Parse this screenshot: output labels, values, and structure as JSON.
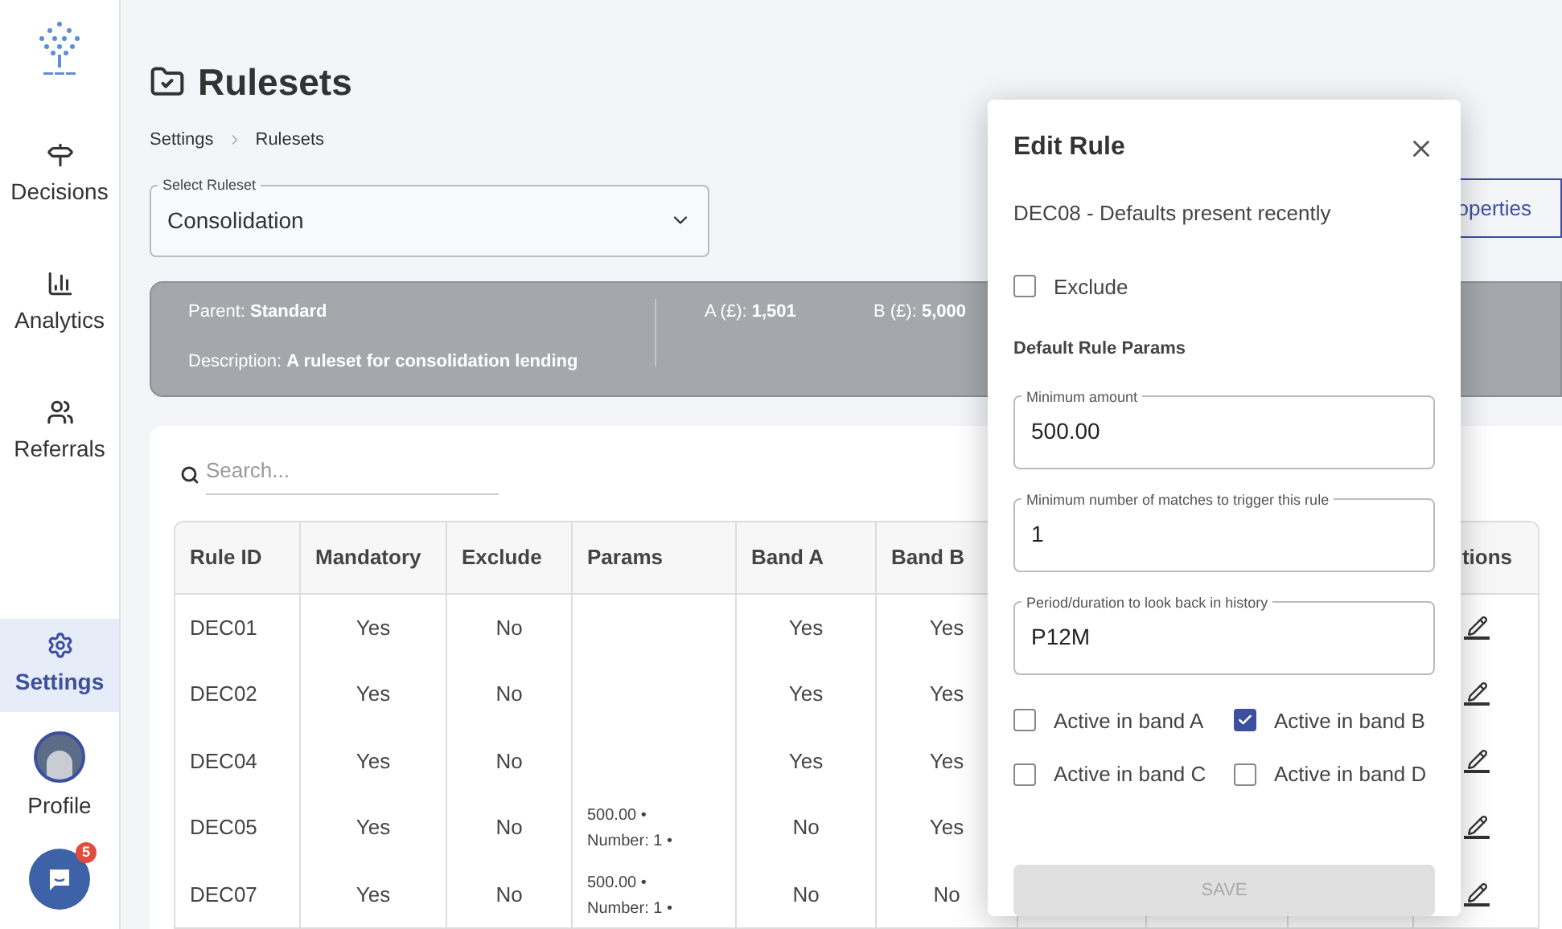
{
  "sidebar": {
    "nav_items": [
      {
        "label": "Decisions",
        "selected": false
      },
      {
        "label": "Analytics",
        "selected": false
      },
      {
        "label": "Referrals",
        "selected": false
      },
      {
        "label": "Settings",
        "selected": true
      }
    ],
    "profile": {
      "label": "Profile"
    },
    "chat": {
      "badge": "5"
    }
  },
  "page": {
    "title": "Rulesets",
    "breadcrumb": [
      "Settings",
      "Rulesets"
    ]
  },
  "ruleset_select": {
    "label": "Select Ruleset",
    "value": "Consolidation"
  },
  "properties_button": {
    "label": "operties"
  },
  "info_panel": {
    "parent_label": "Parent:",
    "parent": "Standard",
    "description_label": "Description:",
    "description": "A ruleset for consolidation lending",
    "band_a_label": "A (£):",
    "band_a": "1,501",
    "band_b_label": "B (£):",
    "band_b": "5,000"
  },
  "search": {
    "placeholder": "Search..."
  },
  "table": {
    "columns": [
      "Rule ID",
      "Mandatory",
      "Exclude",
      "Params",
      "Band A",
      "Band B"
    ],
    "actions_column": "tions",
    "rows": [
      {
        "rule_id": "DEC01",
        "mandatory": "Yes",
        "exclude": "No",
        "band_a": "Yes",
        "band_b": "Yes"
      },
      {
        "rule_id": "DEC02",
        "mandatory": "Yes",
        "exclude": "No",
        "band_a": "Yes",
        "band_b": "Yes"
      },
      {
        "rule_id": "DEC04",
        "mandatory": "Yes",
        "exclude": "No",
        "band_a": "Yes",
        "band_b": "Yes"
      },
      {
        "rule_id": "DEC05",
        "mandatory": "Yes",
        "exclude": "No",
        "params": "500.00 • Number: 1 •",
        "band_a": "No",
        "band_b": "Yes"
      },
      {
        "rule_id": "DEC07",
        "mandatory": "Yes",
        "exclude": "No",
        "params": "500.00 • Number: 1 •",
        "band_a": "No",
        "band_b": "No"
      }
    ]
  },
  "dialog": {
    "title": "Edit Rule",
    "subtitle": "DEC08 - Defaults present recently",
    "exclude": {
      "label": "Exclude",
      "checked": false
    },
    "section_title": "Default Rule Params",
    "fields": [
      {
        "label": "Minimum amount",
        "value": "500.00"
      },
      {
        "label": "Minimum number of matches to trigger this rule",
        "value": "1"
      },
      {
        "label": "Period/duration to look back in history",
        "value": "P12M"
      }
    ],
    "bands": [
      {
        "label": "Active in band A",
        "checked": false
      },
      {
        "label": "Active in band B",
        "checked": true
      },
      {
        "label": "Active in band C",
        "checked": false
      },
      {
        "label": "Active in band D",
        "checked": false
      }
    ],
    "save_button": {
      "label": "SAVE",
      "disabled": true
    }
  }
}
